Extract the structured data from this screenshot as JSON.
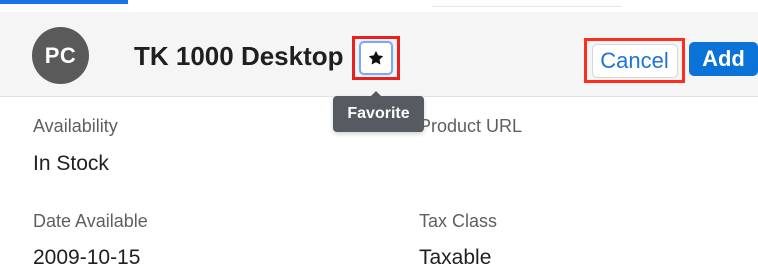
{
  "header": {
    "avatar_text": "PC",
    "title": "TK 1000 Desktop",
    "favorite_icon": "star-icon",
    "cancel_label": "Cancel",
    "add_label": "Add"
  },
  "tooltip": {
    "text": "Favorite"
  },
  "fields": {
    "availability": {
      "label": "Availability",
      "value": "In Stock"
    },
    "product_url": {
      "label": "Product URL",
      "value": ""
    },
    "date_available": {
      "label": "Date Available",
      "value": "2009-10-15"
    },
    "tax_class": {
      "label": "Tax Class",
      "value": "Taxable"
    }
  },
  "colors": {
    "header_bg": "#f5f5f5",
    "avatar_bg": "#5a5a5a",
    "primary_blue": "#0b73d8",
    "link_blue": "#1f73d9",
    "highlight_red": "#e8211f",
    "tooltip_bg": "#555b60"
  }
}
